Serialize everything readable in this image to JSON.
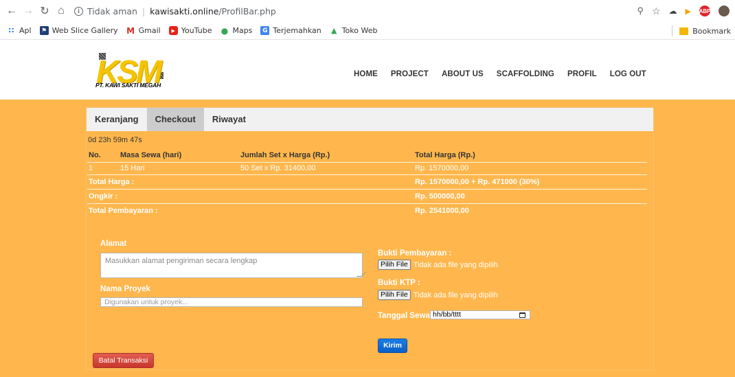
{
  "browser": {
    "security_label": "Tidak aman",
    "host": "kawisakti.online",
    "path": "/ProfilBar.php",
    "ext_abp": "ABP",
    "bookmarks": [
      "Apl",
      "Web Slice Gallery",
      "Gmail",
      "YouTube",
      "Maps",
      "Terjemahkan",
      "Toko Web"
    ],
    "bookmarks_folder": "Bookmark"
  },
  "site": {
    "logo_text": "KSM",
    "company": "PT. KAWI SAKTI MEGAH",
    "menu": [
      "HOME",
      "PROJECT",
      "ABOUT US",
      "SCAFFOLDING",
      "PROFIL",
      "LOG OUT"
    ]
  },
  "tabs": [
    {
      "label": "Keranjang",
      "active": false
    },
    {
      "label": "Checkout",
      "active": true
    },
    {
      "label": "Riwayat",
      "active": false
    }
  ],
  "timer": "0d 23h 59m 47s",
  "table": {
    "headers": [
      "No.",
      "Masa Sewa (hari)",
      "Jumlah Set x Harga (Rp.)",
      "Total Harga (Rp.)"
    ],
    "rows": [
      [
        "1",
        "15 Hari",
        "50 Set x Rp. 31400,00",
        "Rp. 1570000,00"
      ]
    ],
    "summary": [
      {
        "label": "Total Harga :",
        "value": "Rp. 1570000,00 + Rp. 471000 (30%)"
      },
      {
        "label": "Ongkir :",
        "value": "Rp. 500000,00"
      },
      {
        "label": "Total Pembayaran :",
        "value": "Rp. 2541000,00"
      }
    ]
  },
  "form": {
    "alamat_label": "Alamat",
    "alamat_placeholder": "Masukkan alamat pengiriman secara lengkap",
    "proyek_label": "Nama Proyek",
    "proyek_placeholder": "Digunakan untuk proyek...",
    "bukti_label": "Bukti Pembayaran :",
    "ktp_label": "Bukti KTP :",
    "file_button": "Pilih File",
    "file_status": "Tidak ada file yang dipilih",
    "tanggal_label": "Tanggal Sewa :",
    "tanggal_placeholder": "hh/bb/tttt",
    "submit": "Kirim",
    "cancel": "Batal Transaksi"
  },
  "colors": {
    "page_bg": "#ffb74d",
    "logo": "#f5c400",
    "primary_button": "#0a6fd9",
    "danger_button": "#d64b40"
  }
}
